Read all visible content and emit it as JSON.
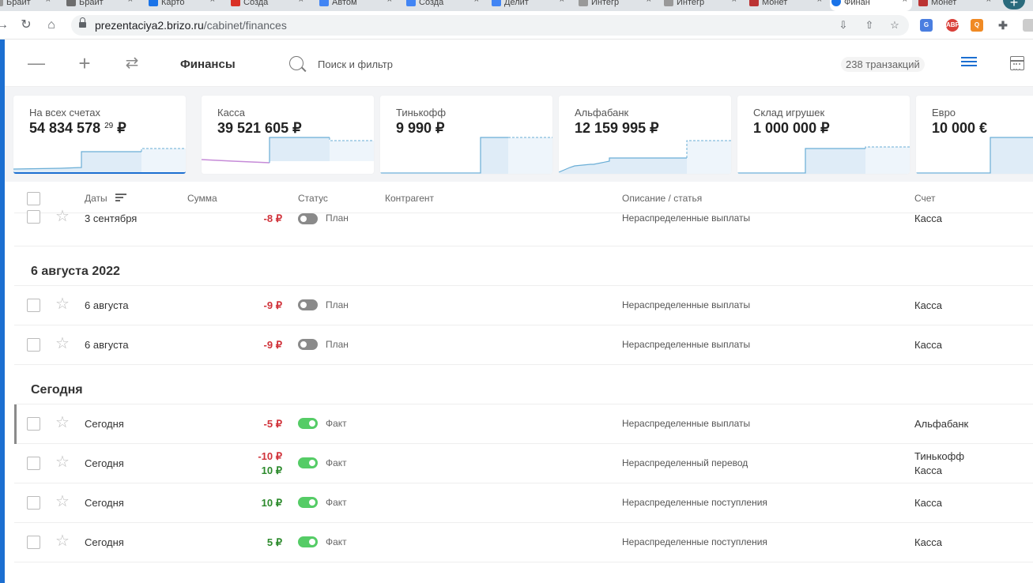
{
  "browser": {
    "tabs": [
      {
        "label": "Брайт",
        "color": "#6d6d6d"
      },
      {
        "label": "Карто",
        "color": "#1a73e8"
      },
      {
        "label": "Созда",
        "color": "#d93025"
      },
      {
        "label": "Автом",
        "color": "#4285f4"
      },
      {
        "label": "Созда",
        "color": "#4285f4"
      },
      {
        "label": "Делит",
        "color": "#4285f4"
      },
      {
        "label": "Интегр",
        "color": "#999999"
      },
      {
        "label": "Интегр",
        "color": "#999999"
      },
      {
        "label": "Монет",
        "color": "#b33"
      },
      {
        "label": "Финан",
        "color": "#1a73e8"
      },
      {
        "label": "Монет",
        "color": "#b33"
      }
    ],
    "url_host": "prezentaciya2.brizo.ru",
    "url_path": "/cabinet/finances"
  },
  "toolbar": {
    "title": "Финансы",
    "search_placeholder": "Поиск и фильтр",
    "transactions_count": "238 транзакций"
  },
  "accounts": [
    {
      "label": "На всех счетах",
      "value": "54 834 578",
      "cents": "29",
      "currency": "₽"
    },
    {
      "label": "Касса",
      "value": "39 521 605 ₽"
    },
    {
      "label": "Тинькофф",
      "value": "9 990 ₽"
    },
    {
      "label": "Альфабанк",
      "value": "12 159 995 ₽"
    },
    {
      "label": "Склад игрушек",
      "value": "1 000 000 ₽"
    },
    {
      "label": "Евро",
      "value": "10 000 €"
    }
  ],
  "table": {
    "headers": {
      "dates": "Даты",
      "amount": "Сумма",
      "status": "Статус",
      "counterparty": "Контрагент",
      "description": "Описание / статья",
      "account": "Счет"
    },
    "groups": [
      {
        "title": "6 августа 2022"
      },
      {
        "title": "Сегодня"
      }
    ],
    "rows": [
      {
        "date": "3 сентября",
        "amount1": "-8 ₽",
        "amount2": "",
        "status": "План",
        "description": "Нераспределенные выплаты",
        "account1": "Касса",
        "account2": ""
      },
      {
        "date": "6 августа",
        "amount1": "-9 ₽",
        "amount2": "",
        "status": "План",
        "description": "Нераспределенные выплаты",
        "account1": "Касса",
        "account2": ""
      },
      {
        "date": "6 августа",
        "amount1": "-9 ₽",
        "amount2": "",
        "status": "План",
        "description": "Нераспределенные выплаты",
        "account1": "Касса",
        "account2": ""
      },
      {
        "date": "Сегодня",
        "amount1": "-5 ₽",
        "amount2": "",
        "status": "Факт",
        "description": "Нераспределенные выплаты",
        "account1": "Альфабанк",
        "account2": ""
      },
      {
        "date": "Сегодня",
        "amount1": "-10 ₽",
        "amount2": "10 ₽",
        "status": "Факт",
        "description": "Нераспределенный перевод",
        "account1": "Тинькофф",
        "account2": "Касса"
      },
      {
        "date": "Сегодня",
        "amount1": "10 ₽",
        "amount2": "",
        "status": "Факт",
        "description": "Нераспределенные поступления",
        "account1": "Касса",
        "account2": ""
      },
      {
        "date": "Сегодня",
        "amount1": "5 ₽",
        "amount2": "",
        "status": "Факт",
        "description": "Нераспределенные поступления",
        "account1": "Касса",
        "account2": ""
      }
    ]
  }
}
